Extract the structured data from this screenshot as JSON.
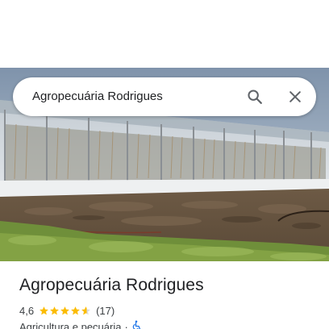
{
  "search": {
    "query": "Agropecuária Rodrigues",
    "search_icon": "search-icon",
    "close_icon": "close-icon"
  },
  "place": {
    "title": "Agropecuária Rodrigues",
    "rating": "4,6",
    "rating_value": 4.6,
    "max_stars": 5,
    "review_count": "(17)",
    "category": "Agricultura e pecuária",
    "separator": "·",
    "accessibility_icon": "wheelchair-icon"
  },
  "colors": {
    "star": "#fbbc04",
    "star_empty": "#dadce0",
    "accessibility": "#1a73e8",
    "text_primary": "#202124",
    "text_secondary": "#3c4043"
  }
}
